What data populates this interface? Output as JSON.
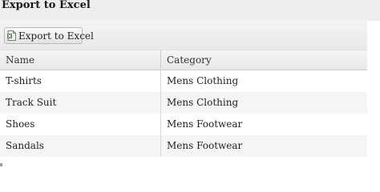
{
  "page": {
    "title": "Export to Excel"
  },
  "toolbar": {
    "export_label": "Export to Excel",
    "export_icon": "excel-file-icon"
  },
  "grid": {
    "columns": [
      "Name",
      "Category"
    ],
    "rows": [
      {
        "name": "T-shirts",
        "category": "Mens Clothing"
      },
      {
        "name": "Track Suit",
        "category": "Mens Clothing"
      },
      {
        "name": "Shoes",
        "category": "Mens Footwear"
      },
      {
        "name": "Sandals",
        "category": "Mens Footwear"
      }
    ]
  },
  "colors": {
    "header_bg": "#eeeeee",
    "alt_row": "#f5f5f5",
    "border": "#d0d0d0"
  }
}
